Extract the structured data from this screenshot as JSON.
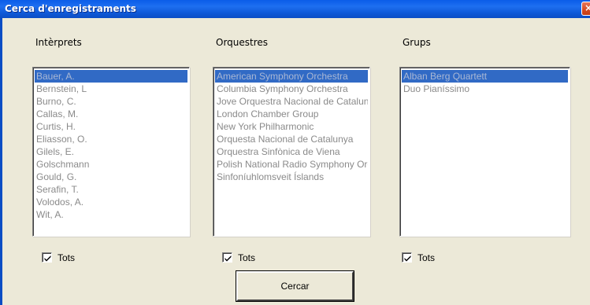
{
  "window": {
    "title": "Cerca d'enregistraments",
    "close_label": "×"
  },
  "columns": [
    {
      "label": "Intèrprets",
      "items": [
        "Bauer, A.",
        "Bernstein, L",
        "Burno, C.",
        "Callas, M.",
        "Curtis, H.",
        "Eliasson, O.",
        "Gilels, E.",
        "Golschmann",
        "Gould, G.",
        "Serafin, T.",
        "Volodos, A.",
        "Wit, A."
      ],
      "selected_index": 0,
      "checkbox_label": "Tots",
      "checked": true
    },
    {
      "label": "Orquestres",
      "items": [
        "American Symphony Orchestra",
        "Columbia Symphony Orchestra",
        "Jove Orquestra Nacional de Catalunya",
        "London Chamber Group",
        "New York Philharmonic",
        "Orquesta Nacional de Catalunya",
        "Orquestra Sinfònica de Viena",
        "Polish National Radio Symphony Orchestra",
        "Sinfoníuhlomsveit Íslands"
      ],
      "selected_index": 0,
      "checkbox_label": "Tots",
      "checked": true
    },
    {
      "label": "Grups",
      "items": [
        "Alban Berg Quartett",
        "Duo Pianíssimo"
      ],
      "selected_index": 0,
      "checkbox_label": "Tots",
      "checked": true
    }
  ],
  "search_button": {
    "label": "Cercar"
  },
  "colors": {
    "titlebar": "#0a5ce8",
    "dialog_bg": "#ece9d8",
    "selection": "#316ac5",
    "disabled_text": "#8a8a8a"
  }
}
